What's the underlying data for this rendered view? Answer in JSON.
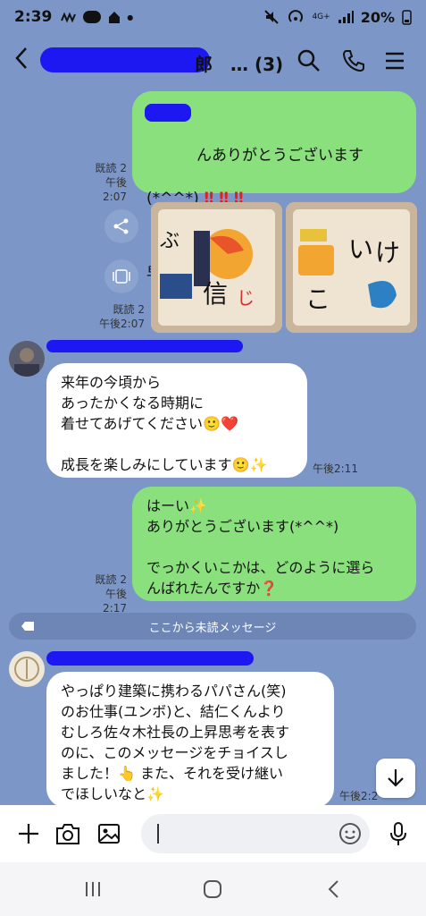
{
  "status": {
    "time": "2:39",
    "battery": "20%",
    "network": "4G+"
  },
  "header": {
    "title_tail": "郎　…",
    "member_count": "(3)"
  },
  "messages": {
    "m1": {
      "text_lines": [
        "んありがとうございます",
        "(*^^*)‼️‼️‼️",
        "",
        "早く着せたいです❤️"
      ],
      "read": "既読 2",
      "time": "午後2:07"
    },
    "m2": {
      "read": "既読 2",
      "time": "午後2:07"
    },
    "m3": {
      "text": "来年の今頃から\nあったかくなる時期に\n着せてあげてください🙂❤️\n\n成長を楽しみにしています🙂✨",
      "time": "午後2:11"
    },
    "m4": {
      "text": "はーい✨\nありがとうございます(*^^*)\n\nでっかくいこかは、どのように選ら\nんばれたんですか❓",
      "read": "既読 2",
      "time": "午後2:17"
    },
    "unread": "ここから未読メッセージ",
    "m5": {
      "text": "やっぱり建築に携わるパパさん(笑)\nのお仕事(ユンボ)と、結仁くんより\nむしろ佐々木社長の上昇思考を表す\nのに、このメッセージをチョイスし\nました！👆 また、それを受け継い\nでほしいなと✨",
      "time": "午後2:2"
    }
  },
  "colors": {
    "chat_bg": "#7c97c7",
    "mine_bubble": "#8be07e",
    "theirs_bubble": "#ffffff",
    "redaction": "#1d17f2"
  },
  "icons": [
    "search-icon",
    "phone-icon",
    "menu-icon",
    "share-icon",
    "keep-icon",
    "plus-icon",
    "camera-icon",
    "image-icon",
    "emoji-icon",
    "mic-icon",
    "down-arrow-icon",
    "recents-icon",
    "home-icon",
    "back-icon"
  ]
}
